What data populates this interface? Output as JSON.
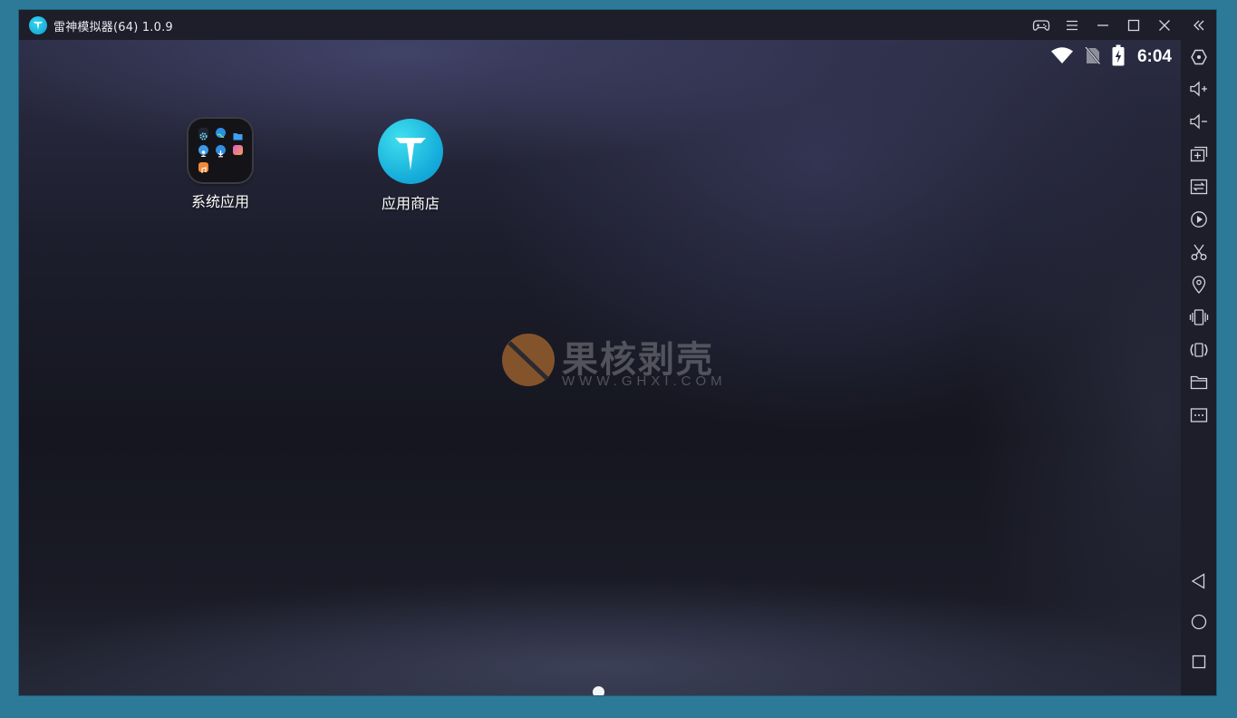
{
  "window": {
    "title": "雷神模拟器(64) 1.0.9"
  },
  "titlebar_icons": [
    "gamepad-icon",
    "menu-icon",
    "minimize-icon",
    "maximize-icon",
    "close-icon"
  ],
  "status_bar": {
    "time": "6:04",
    "icons": [
      "wifi-icon",
      "no-sim-icon",
      "battery-charging-icon"
    ]
  },
  "desktop": {
    "apps": [
      {
        "label": "系统应用",
        "icon": "system-apps-folder-icon"
      },
      {
        "label": "应用商店",
        "icon": "app-store-icon"
      }
    ],
    "page_indicator": {
      "pages": 1,
      "current": 1
    }
  },
  "watermark": {
    "brand": "果核剥壳",
    "url": "WWW.GHXI.COM"
  },
  "sidebar": {
    "top_tools": [
      "collapse-icon",
      "keymap-icon",
      "volume-up-icon",
      "volume-down-icon",
      "multi-instance-icon",
      "sync-icon",
      "record-icon",
      "screenshot-icon",
      "location-icon",
      "shake-icon",
      "rotate-icon",
      "folder-icon",
      "more-icon"
    ],
    "nav": [
      "back-icon",
      "home-icon",
      "recents-icon"
    ]
  },
  "colors": {
    "accent": "#13a9d9",
    "chrome": "#1d1e2a",
    "background": "#2d7a98"
  }
}
